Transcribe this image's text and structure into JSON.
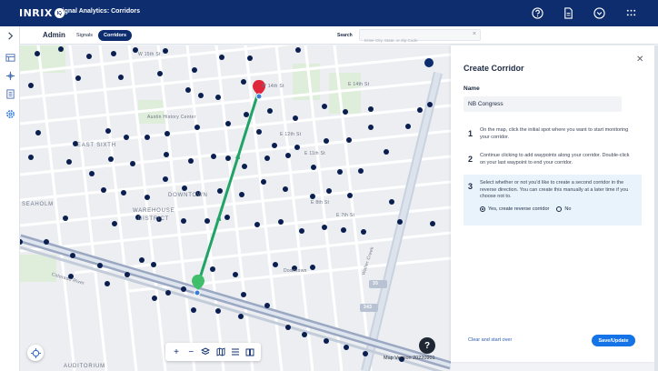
{
  "app": {
    "logo_text": "INRIX",
    "logo_badge": "IQ",
    "title": "Signal Analytics: Corridors"
  },
  "topbar_icons": [
    "help-circle-icon",
    "document-icon",
    "chevron-circle-icon",
    "apps-grid-icon"
  ],
  "subbar": {
    "admin_label": "Admin",
    "tabs": [
      {
        "label": "Signals",
        "active": false
      },
      {
        "label": "Corridors",
        "active": true
      }
    ],
    "search_label": "Search",
    "search_placeholder": "Enter City, State, or Zip Code",
    "search_value": ""
  },
  "map": {
    "labels": {
      "street_15th": "W 15th St",
      "street_14th": "W 14th St",
      "street_e14th": "E 14th St",
      "street_e12th": "E 12th St",
      "street_e11th": "E 11th St",
      "street_e8th": "E 8th St",
      "street_e7th": "E 7th St",
      "museum": "Austin History Center",
      "east_sixth": "EAST SIXTH",
      "downtown": "DOWNTOWN",
      "warehouse": "WAREHOUSE",
      "district": "DISTRICT",
      "seaholm": "SEAHOLM",
      "colorado_river": "Colorado River",
      "downtown_station": "Downtown",
      "waller_creek": "Waller Creek",
      "auditorium": "AUDITORIUM",
      "hwy_35": "35",
      "hwy_343": "343"
    },
    "version_text": "Map Version 20220901",
    "help_glyph": "?",
    "route_color": "#21a366",
    "start_pin_color": "#e0263b",
    "end_pin_color": "#3fbf6a",
    "signal_color": "#0a1e4f"
  },
  "map_toolbar": {
    "zoom_in": "+",
    "zoom_out": "−",
    "tools": [
      "layers-icon",
      "map-icon",
      "list-icon",
      "book-icon"
    ]
  },
  "panel": {
    "title": "Create Corridor",
    "close": "✕",
    "name_label": "Name",
    "name_value": "NB Congress",
    "steps": [
      {
        "num": "1",
        "text": "On the map, click the initial spot where you want to start monitoring your corridor."
      },
      {
        "num": "2",
        "text": "Continue clicking to add waypoints along your corridor. Double-click on your last waypoint to end your corridor."
      },
      {
        "num": "3",
        "text": "Select whether or not you'd like to create a second corridor in the reverse direction. You can create this manually at a later time if you choose not to."
      }
    ],
    "reverse_options": [
      {
        "label": "Yes, create reverse corridor",
        "selected": true
      },
      {
        "label": "No",
        "selected": false
      }
    ],
    "clear_label": "Clear and start over",
    "save_label": "Save/Update"
  }
}
